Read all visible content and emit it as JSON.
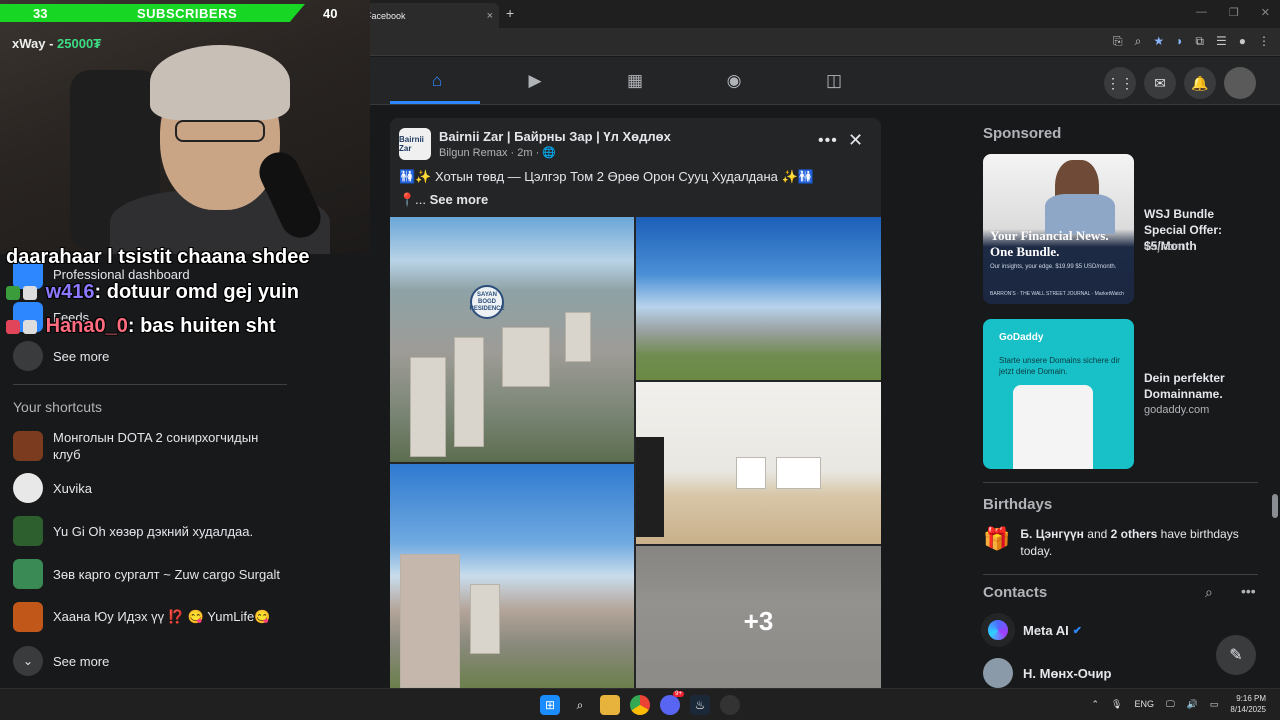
{
  "browser": {
    "tab_title": "Facebook",
    "tab_icon": "f",
    "close_glyph": "×",
    "newtab_glyph": "+",
    "window_controls": [
      "—",
      "❐",
      "✕"
    ]
  },
  "stream": {
    "sub_current": "33",
    "sub_label": "SUBSCRIBERS",
    "sub_goal": "40",
    "sub_fraction": 0.83,
    "donation_user": "xWay",
    "donation_amount": "25000₮",
    "chat": [
      {
        "text": "daarahaar l tsistit chaana shdee"
      },
      {
        "user": "w416",
        "sep": ":",
        "text": "dotuur omd gej yuin"
      },
      {
        "user": "Hana0_0",
        "sep": ":",
        "text": "bas huiten sht"
      }
    ]
  },
  "sidebar": {
    "items": [
      {
        "label": "Professional dashboard"
      },
      {
        "label": "Feeds"
      },
      {
        "label": "See more"
      }
    ],
    "shortcuts_title": "Your shortcuts",
    "shortcuts": [
      {
        "label": "Монголын DOTA 2 сонирхогчидын клуб",
        "color": "#7a3b1e"
      },
      {
        "label": "Xuvika",
        "color": "#e8e8e8"
      },
      {
        "label": "Yu Gi Oh хөзөр дэкний худалдаа.",
        "color": "#2c5f2d"
      },
      {
        "label": "Зөв карго сургалт ~ Zuw cargo Surgalt",
        "color": "#3a8a55"
      },
      {
        "label": "Хаана Юу Идэх үү ⁉️ 😋 YumLife😋",
        "color": "#c2571a"
      }
    ],
    "see_more_2": "See more"
  },
  "post": {
    "avatar_text": "Bairnii Zar",
    "author": "Bairnii Zar | Байрны Зар | Үл Хөдлөх",
    "meta": "Bilgun Remax · 2m · 🌐",
    "text": "🚻✨ Хотын төвд — Цэлгэр Том 2 Өрөө Орон Сууц Худалдана ✨🚻",
    "see_more_prefix": "📍... ",
    "see_more": "See more",
    "more_glyph": "•••",
    "close_glyph": "✕",
    "extra_photos": "+3",
    "seal_text": "SAYAN BOGD RESIDENCE"
  },
  "right": {
    "sponsored_title": "Sponsored",
    "ads": [
      {
        "title": "WSJ Bundle Special Offer: $5/Month",
        "source": "wsj.com",
        "headline": "Your Financial News. One Bundle.",
        "small": "Our insights, your edge. $19.99 $5 USD/month.",
        "footer": "BARRON'S · THE WALL STREET JOURNAL · MarketWatch"
      },
      {
        "title": "Dein perfekter Domainname.",
        "source": "godaddy.com",
        "brand": "GoDaddy",
        "small": "Starte unsere Domains sichere dir jetzt deine Domain."
      }
    ],
    "birthdays_title": "Birthdays",
    "birthday_name": "Б. Цэнгүүн",
    "birthday_and": " and ",
    "birthday_others": "2 others",
    "birthday_rest": " have birthdays today.",
    "contacts_title": "Contacts",
    "contacts": [
      {
        "name": "Meta AI",
        "verified": "✔"
      },
      {
        "name": "Н. Мөнх-Очир"
      }
    ]
  },
  "taskbar": {
    "lang": "ENG",
    "time": "9:16 PM",
    "date": "8/14/2025",
    "discord_badge": "9+"
  },
  "colors": {
    "fb_blue": "#2d88ff",
    "sub_green": "#17d624",
    "chat_user_1": "#8a78ff",
    "chat_user_2": "#ff6b7f"
  }
}
